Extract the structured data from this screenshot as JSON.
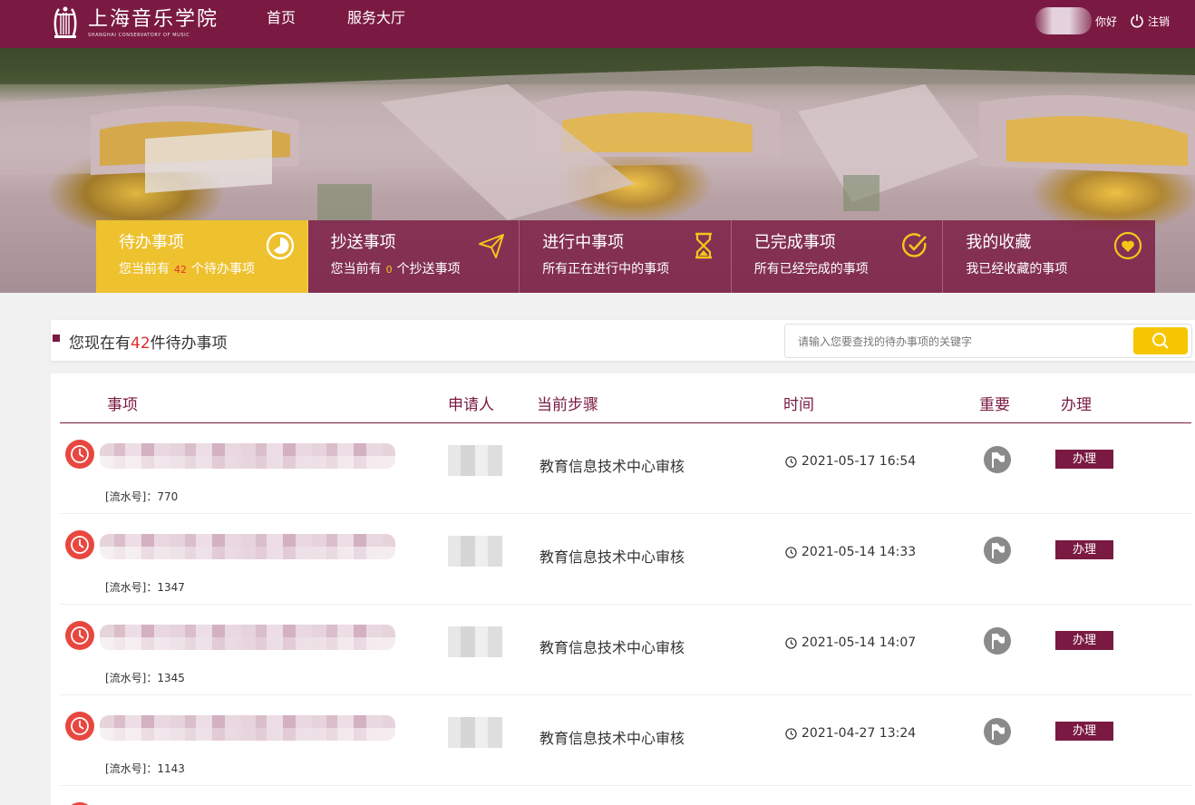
{
  "header": {
    "logo_cn": "上海音乐学院",
    "logo_en": "SHANGHAI CONSERVATORY OF MUSIC",
    "nav": [
      "首页",
      "服务大厅"
    ],
    "greeting": "你好",
    "logout": "注销"
  },
  "tiles": [
    {
      "title": "待办事项",
      "pre": "您当前有",
      "num": "42",
      "post": "个待办事项",
      "icon": "pie-clock-icon",
      "active": true
    },
    {
      "title": "抄送事项",
      "pre": "您当前有",
      "num": "0",
      "post": "个抄送事项",
      "icon": "paper-plane-icon",
      "active": false
    },
    {
      "title": "进行中事项",
      "sub": "所有正在进行中的事项",
      "icon": "hourglass-icon",
      "active": false
    },
    {
      "title": "已完成事项",
      "sub": "所有已经完成的事项",
      "icon": "check-circle-icon",
      "active": false
    },
    {
      "title": "我的收藏",
      "sub": "我已经收藏的事项",
      "icon": "heart-circle-icon",
      "active": false
    }
  ],
  "count": {
    "pre": "您现在有",
    "num": "42",
    "post": "件待办事项"
  },
  "search": {
    "placeholder": "请输入您要查找的待办事项的关键字"
  },
  "table": {
    "headers": [
      "事项",
      "申请人",
      "当前步骤",
      "时间",
      "重要",
      "办理"
    ],
    "rows": [
      {
        "serial": "[流水号]：770",
        "step": "教育信息技术中心审核",
        "time": "2021-05-17 16:54",
        "action": "办理"
      },
      {
        "serial": "[流水号]：1347",
        "step": "教育信息技术中心审核",
        "time": "2021-05-14 14:33",
        "action": "办理"
      },
      {
        "serial": "[流水号]：1345",
        "step": "教育信息技术中心审核",
        "time": "2021-05-14 14:07",
        "action": "办理"
      },
      {
        "serial": "[流水号]：1143",
        "step": "教育信息技术中心审核",
        "time": "2021-04-27 13:24",
        "action": "办理"
      }
    ]
  },
  "colors": {
    "brand": "#7a1a42",
    "accent": "#eec12e",
    "alert": "#e8473f"
  }
}
